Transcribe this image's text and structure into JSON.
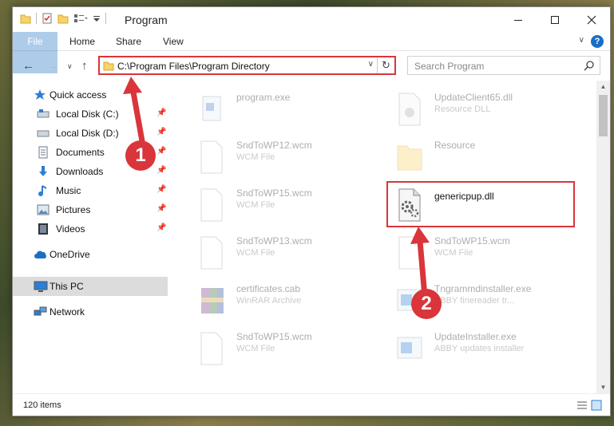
{
  "window": {
    "title": "Program"
  },
  "ribbon": {
    "tabs": [
      "File",
      "Home",
      "Share",
      "View"
    ]
  },
  "address": {
    "path": "C:\\Program Files\\Program Directory"
  },
  "search": {
    "placeholder": "Search Program"
  },
  "sidebar": {
    "items": [
      {
        "label": "Quick access",
        "icon": "star-icon",
        "pinned": false
      },
      {
        "label": "Local Disk (C:)",
        "icon": "drive-icon",
        "pinned": true
      },
      {
        "label": "Local Disk (D:)",
        "icon": "drive-icon",
        "pinned": true
      },
      {
        "label": "Documents",
        "icon": "documents-icon",
        "pinned": true
      },
      {
        "label": "Downloads",
        "icon": "download-icon",
        "pinned": true
      },
      {
        "label": "Music",
        "icon": "music-icon",
        "pinned": true
      },
      {
        "label": "Pictures",
        "icon": "pictures-icon",
        "pinned": true
      },
      {
        "label": "Videos",
        "icon": "videos-icon",
        "pinned": true
      },
      {
        "label": "OneDrive",
        "icon": "cloud-icon",
        "pinned": false
      },
      {
        "label": "This PC",
        "icon": "computer-icon",
        "pinned": false
      },
      {
        "label": "Network",
        "icon": "network-icon",
        "pinned": false
      }
    ]
  },
  "files": {
    "left": [
      {
        "name": "program.exe",
        "type": ""
      },
      {
        "name": "SndToWP12.wcm",
        "type": "WCM File"
      },
      {
        "name": "SndToWP15.wcm",
        "type": "WCM File"
      },
      {
        "name": "SndToWP13.wcm",
        "type": "WCM File"
      },
      {
        "name": "certificates.cab",
        "type": "WinRAR Archive"
      },
      {
        "name": "SndToWP15.wcm",
        "type": "WCM File"
      }
    ],
    "right": [
      {
        "name": "UpdateClient65.dll",
        "type": "Resource DLL"
      },
      {
        "name": "Resource",
        "type": ""
      },
      {
        "name": "genericpup.dll",
        "type": ""
      },
      {
        "name": "SndToWP15.wcm",
        "type": "WCM File"
      },
      {
        "name": "Tngrammdinstaller.exe",
        "type": "ABBY finereader tr..."
      },
      {
        "name": "UpdateInstaller.exe",
        "type": "ABBY updates installer"
      }
    ]
  },
  "status": {
    "count": "120 items"
  },
  "callouts": {
    "one": "1",
    "two": "2"
  },
  "colors": {
    "accent": "#1a6fc4",
    "highlight": "#d9353a"
  }
}
